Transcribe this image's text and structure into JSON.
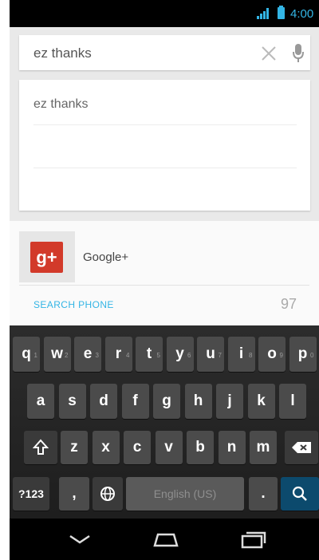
{
  "status_bar": {
    "time": "4:00"
  },
  "search": {
    "query": "ez thanks"
  },
  "suggestions": [
    {
      "text": "ez thanks"
    }
  ],
  "results": {
    "app_name": "Google+",
    "app_icon_text": "g+",
    "search_phone_label": "SEARCH PHONE",
    "count": "97"
  },
  "keyboard": {
    "row1": [
      {
        "label": "q",
        "hint": "1"
      },
      {
        "label": "w",
        "hint": "2"
      },
      {
        "label": "e",
        "hint": "3"
      },
      {
        "label": "r",
        "hint": "4"
      },
      {
        "label": "t",
        "hint": "5"
      },
      {
        "label": "y",
        "hint": "6"
      },
      {
        "label": "u",
        "hint": "7"
      },
      {
        "label": "i",
        "hint": "8"
      },
      {
        "label": "o",
        "hint": "9"
      },
      {
        "label": "p",
        "hint": "0"
      }
    ],
    "row2": [
      "a",
      "s",
      "d",
      "f",
      "g",
      "h",
      "j",
      "k",
      "l"
    ],
    "row3": [
      "z",
      "x",
      "c",
      "v",
      "b",
      "n",
      "m"
    ],
    "symbols_label": "?123",
    "comma_label": ",",
    "space_label": "English (US)",
    "period_label": ".",
    "shift_icon": "shift-icon",
    "backspace_icon": "backspace-icon",
    "globe_icon": "globe-icon",
    "search_icon": "search-icon"
  },
  "navbar": {
    "icons": [
      "back-icon",
      "home-icon",
      "recent-apps-icon"
    ]
  },
  "colors": {
    "accent": "#33b5e5",
    "gplus_red": "#d23a2a",
    "search_key": "#0c4a6d"
  }
}
